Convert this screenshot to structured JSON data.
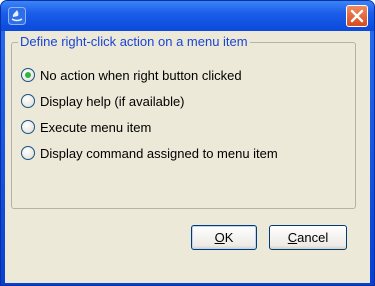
{
  "window": {
    "title": "",
    "close_icon": "close-icon",
    "app_icon": "java-app-icon"
  },
  "group": {
    "legend": "Define right-click action on a menu item"
  },
  "options": [
    {
      "label": "No action when right button clicked",
      "checked": true
    },
    {
      "label": "Display help (if available)",
      "checked": false
    },
    {
      "label": "Execute menu item",
      "checked": false
    },
    {
      "label": "Display command assigned to menu item",
      "checked": false
    }
  ],
  "buttons": {
    "ok": {
      "mnemonic": "O",
      "rest": "K"
    },
    "cancel": {
      "mnemonic": "C",
      "rest": "ancel"
    }
  },
  "colors": {
    "title_bar": "#0a49dc",
    "legend_text": "#1a44d6",
    "close_button": "#d64b1d",
    "dialog_bg": "#ece9d8"
  }
}
